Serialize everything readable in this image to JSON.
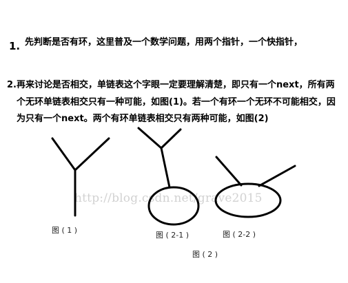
{
  "paragraph_1": {
    "number": "1.",
    "text": "先判断是否有环，这里普及一个数学问题，用两个指针，一个快指针，"
  },
  "paragraph_2": {
    "lines": [
      "2.再来讨论是否相交，单链表这个字眼一定要理解清楚，即只有一个next，所有两",
      "个无环单链表相交只有一种可能，如图(1)。若一个有环一个无环不可能相交，因",
      "为只有一个next。两个有环单链表相交只有两种可能，如图(2)"
    ]
  },
  "figures": {
    "fig1_caption": "图 ( 1 )",
    "fig2_1_caption": "图 ( 2-1 )",
    "fig2_2_caption": "图 ( 2-2 )",
    "fig2_caption": "图 ( 2 )"
  },
  "watermark": "http://blog.csdn.net/grave2015"
}
